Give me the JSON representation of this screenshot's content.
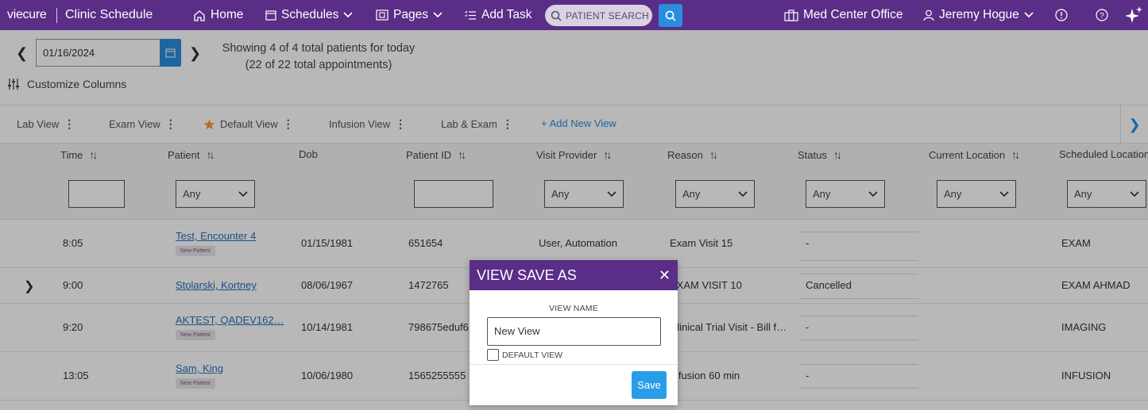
{
  "nav": {
    "brand": "viecure",
    "app_title": "Clinic Schedule",
    "home": "Home",
    "schedules": "Schedules",
    "pages": "Pages",
    "add_task": "Add Task",
    "search_placeholder": "PATIENT SEARCH",
    "office": "Med Center Office",
    "user": "Jeremy Hogue"
  },
  "toolbar": {
    "date": "01/16/2024",
    "showing_line1": "Showing 4 of 4 total patients for today",
    "showing_line2": "(22 of 22 total appointments)",
    "customize": "Customize Columns"
  },
  "views": {
    "tabs": [
      "Lab View",
      "Exam View",
      "Default View",
      "Infusion View",
      "Lab & Exam"
    ],
    "add": "+ Add New View"
  },
  "columns": [
    "Time",
    "Patient",
    "Dob",
    "Patient ID",
    "Visit Provider",
    "Reason",
    "Status",
    "Current Location",
    "Scheduled Location"
  ],
  "filters": {
    "any": "Any"
  },
  "rows": [
    {
      "time": "8:05",
      "patient": "Test, Encounter 4",
      "badge": "New Patient",
      "dob": "01/15/1981",
      "pid": "651654",
      "provider": "User, Automation",
      "reason": "Exam Visit 15",
      "status": "-",
      "sched": "EXAM"
    },
    {
      "time": "9:00",
      "patient": "Stolarski, Kortney",
      "badge": "",
      "dob": "08/06/1967",
      "pid": "1472765",
      "provider": "",
      "reason": "EXAM VISIT 10",
      "status": "Cancelled",
      "sched": "EXAM AHMAD"
    },
    {
      "time": "9:20",
      "patient": "AKTEST, QADEV162…",
      "badge": "New Patient",
      "dob": "10/14/1981",
      "pid": "798675eduf6",
      "provider": "",
      "reason": "Clinical Trial Visit - Bill f…",
      "status": "-",
      "sched": "IMAGING"
    },
    {
      "time": "13:05",
      "patient": "Sam, King",
      "badge": "New Patient",
      "dob": "10/06/1980",
      "pid": "1565255555",
      "provider": "",
      "reason": "Infusion 60 min",
      "status": "-",
      "sched": "INFUSION"
    }
  ],
  "modal": {
    "title": "VIEW SAVE AS",
    "label": "VIEW NAME",
    "value": "New View",
    "checkbox_label": "DEFAULT VIEW",
    "save": "Save"
  },
  "colors": {
    "brand_purple": "#5a2d86",
    "accent_blue": "#2a8de0"
  }
}
